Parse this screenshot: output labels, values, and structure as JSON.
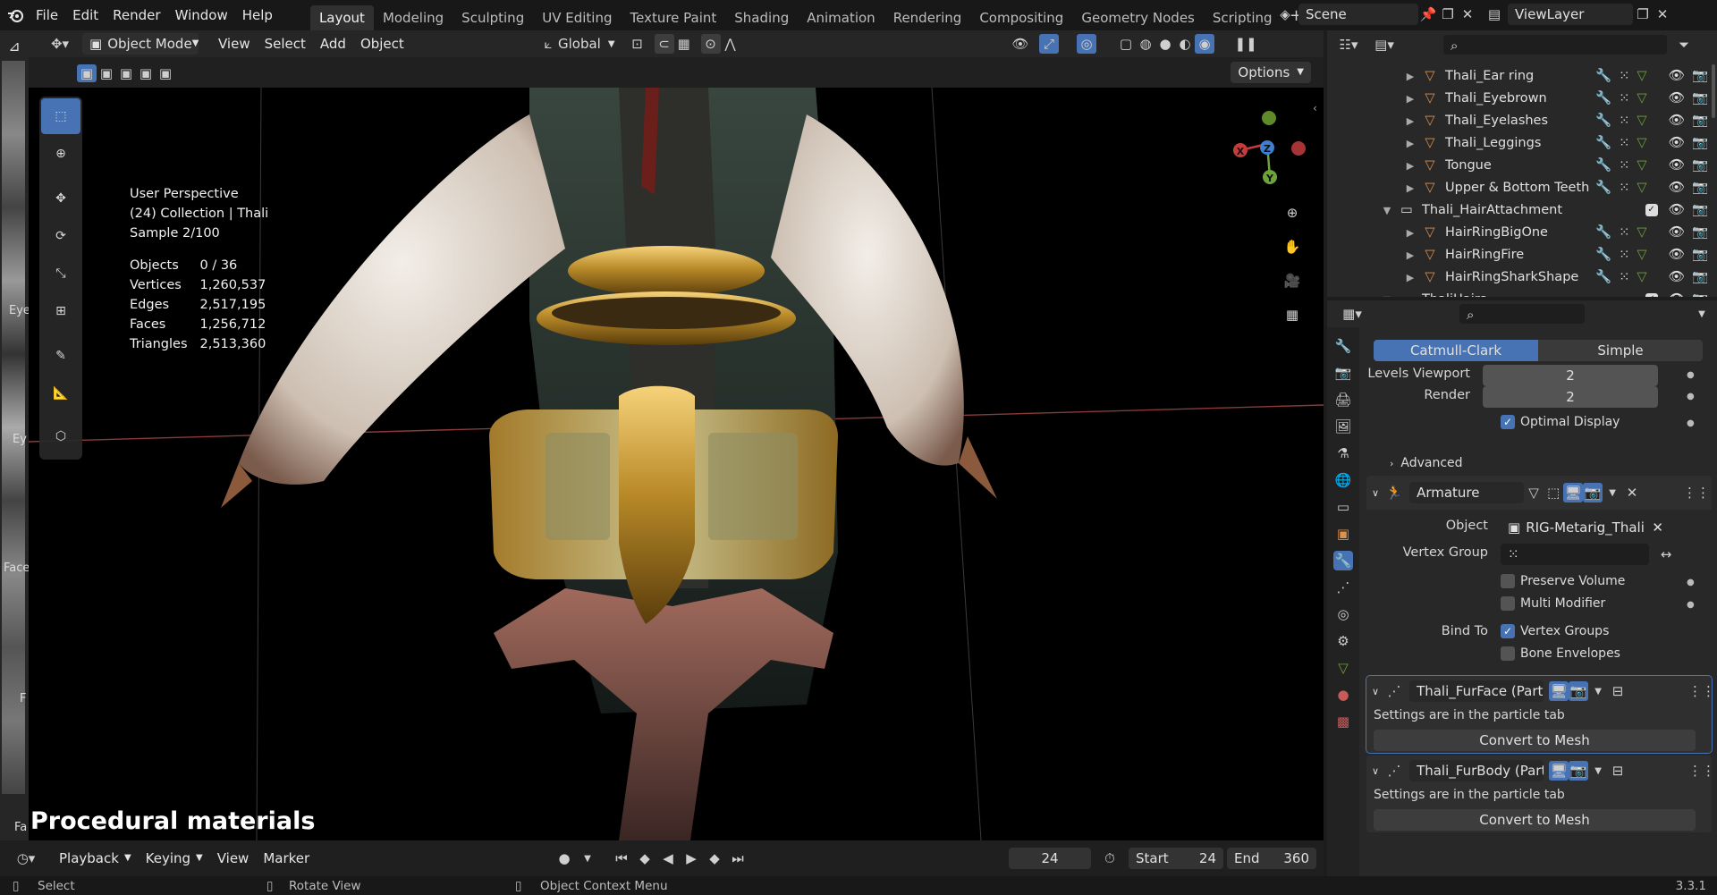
{
  "menubar": {
    "items": [
      "File",
      "Edit",
      "Render",
      "Window",
      "Help"
    ]
  },
  "workspaces": {
    "tabs": [
      "Layout",
      "Modeling",
      "Sculpting",
      "UV Editing",
      "Texture Paint",
      "Shading",
      "Animation",
      "Rendering",
      "Compositing",
      "Geometry Nodes",
      "Scripting"
    ],
    "active": "Layout"
  },
  "scene": {
    "name": "Scene",
    "view_layer": "ViewLayer"
  },
  "viewport_header": {
    "mode": "Object Mode",
    "menus": [
      "View",
      "Select",
      "Add",
      "Object"
    ],
    "orientation": "Global",
    "options_label": "Options"
  },
  "overlay": {
    "lines": [
      "User Perspective",
      "(24) Collection | Thali",
      "Sample 2/100"
    ],
    "stats": [
      [
        "Objects",
        "0 / 36"
      ],
      [
        "Vertices",
        "1,260,537"
      ],
      [
        "Edges",
        "2,517,195"
      ],
      [
        "Faces",
        "1,256,712"
      ],
      [
        "Triangles",
        "2,513,360"
      ]
    ],
    "caption": "Procedural materials"
  },
  "gizmo": {
    "x": "X",
    "y": "Y",
    "z": "Z"
  },
  "left_strip": {
    "labels": [
      "Eye",
      "Ey",
      "Face",
      "F",
      "Fa"
    ]
  },
  "outliner": {
    "rows": [
      {
        "name": "Thali_Ear ring",
        "indent": 2,
        "type": "mesh",
        "expanded": false
      },
      {
        "name": "Thali_Eyebrown",
        "indent": 2,
        "type": "mesh",
        "expanded": false
      },
      {
        "name": "Thali_Eyelashes",
        "indent": 2,
        "type": "mesh",
        "expanded": false
      },
      {
        "name": "Thali_Leggings",
        "indent": 2,
        "type": "mesh",
        "expanded": false
      },
      {
        "name": "Tongue",
        "indent": 2,
        "type": "mesh",
        "expanded": false
      },
      {
        "name": "Upper & Bottom Teeth",
        "indent": 2,
        "type": "mesh",
        "expanded": false
      },
      {
        "name": "Thali_HairAttachment",
        "indent": 1,
        "type": "collection",
        "expanded": true
      },
      {
        "name": "HairRingBigOne",
        "indent": 2,
        "type": "mesh",
        "expanded": false
      },
      {
        "name": "HairRingFire",
        "indent": 2,
        "type": "mesh",
        "expanded": false
      },
      {
        "name": "HairRingSharkShape",
        "indent": 2,
        "type": "mesh",
        "expanded": false
      },
      {
        "name": "ThaliHairs",
        "indent": 1,
        "type": "collection",
        "expanded": true
      }
    ]
  },
  "properties": {
    "subdiv": {
      "tabs": [
        "Catmull-Clark",
        "Simple"
      ],
      "active": "Catmull-Clark",
      "levels_viewport_label": "Levels Viewport",
      "levels_viewport": "2",
      "render_label": "Render",
      "render": "2",
      "optimal_display": "Optimal Display",
      "advanced": "Advanced"
    },
    "armature": {
      "name": "Armature",
      "object_label": "Object",
      "object": "RIG-Metarig_Thali",
      "vertex_group_label": "Vertex Group",
      "vertex_group": "",
      "preserve_volume": "Preserve Volume",
      "multi_modifier": "Multi Modifier",
      "bind_to_label": "Bind To",
      "vertex_groups": "Vertex Groups",
      "bone_envelopes": "Bone Envelopes"
    },
    "particle_mods": [
      {
        "name": "Thali_FurFace (ParticleSy...",
        "info": "Settings are in the particle tab",
        "button": "Convert to Mesh"
      },
      {
        "name": "Thali_FurBody (ParticleSy...",
        "info": "Settings are in the particle tab",
        "button": "Convert to Mesh"
      }
    ]
  },
  "timeline": {
    "menus": [
      "Playback",
      "Keying",
      "View",
      "Marker"
    ],
    "current_frame": "24",
    "start_label": "Start",
    "start": "24",
    "end_label": "End",
    "end": "360"
  },
  "statusbar": {
    "items": [
      "Select",
      "Rotate View",
      "Object Context Menu"
    ],
    "version": "3.3.1"
  },
  "colors": {
    "accent": "#4772b3",
    "mesh_icon": "#e0914a",
    "object_icon": "#e0914a",
    "x_axis": "#c43c3c",
    "y_axis": "#6ea23a",
    "z_axis": "#3f7fd1"
  }
}
